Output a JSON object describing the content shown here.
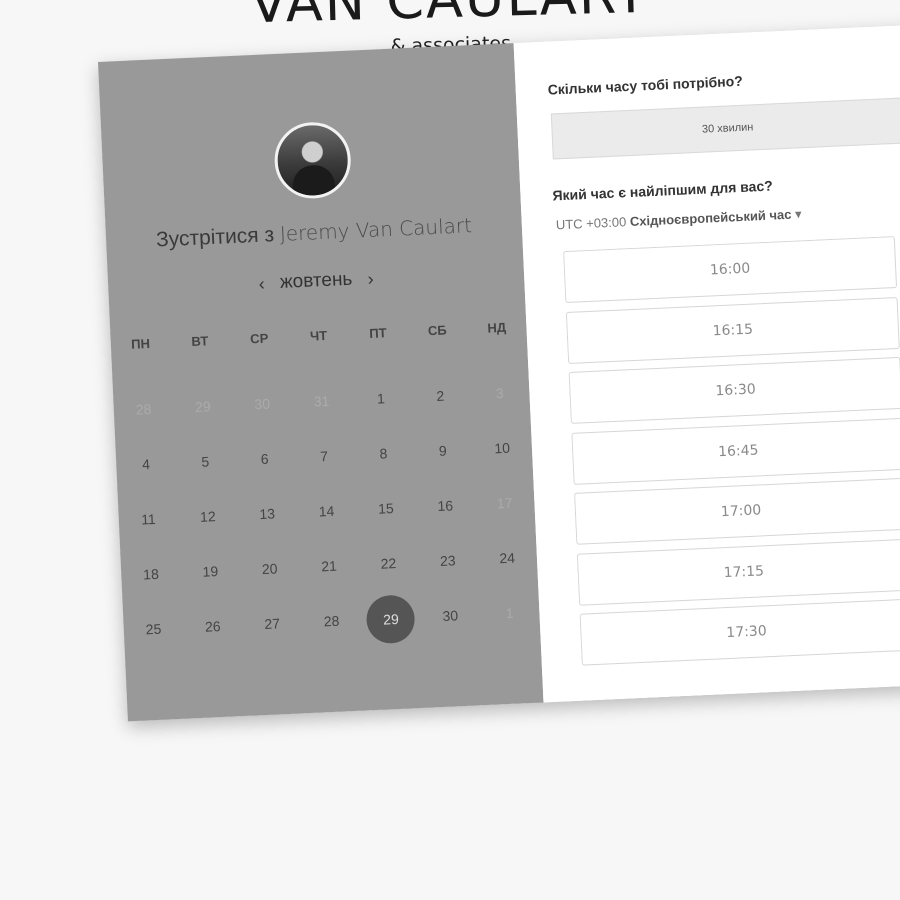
{
  "brand": {
    "title": "VAN CAULART",
    "subtitle": "& associates"
  },
  "left": {
    "meet_prefix": "Зустрітися з",
    "host": "Jeremy Van Caulart",
    "month": "жовтень",
    "prev_icon": "‹",
    "next_icon": "›",
    "weekdays": [
      "ПН",
      "ВТ",
      "СР",
      "ЧТ",
      "ПТ",
      "СБ",
      "НД"
    ],
    "weeks": [
      [
        "28",
        "29",
        "30",
        "31",
        "1",
        "2",
        "3"
      ],
      [
        "4",
        "5",
        "6",
        "7",
        "8",
        "9",
        "10"
      ],
      [
        "11",
        "12",
        "13",
        "14",
        "15",
        "16",
        "17"
      ],
      [
        "18",
        "19",
        "20",
        "21",
        "22",
        "23",
        "24"
      ],
      [
        "25",
        "26",
        "27",
        "28",
        "29",
        "30",
        "1"
      ]
    ],
    "muted_days": [
      "0-0",
      "0-1",
      "0-2",
      "0-3",
      "0-6",
      "2-6",
      "4-6"
    ],
    "selected_day": "29"
  },
  "right": {
    "duration_question": "Скільки часу тобі потрібно?",
    "duration_value": "30 хвилин",
    "time_question": "Який час є найліпшим для вас?",
    "tz_offset": "UTC +03:00",
    "tz_name": "Східноєвропейський час",
    "tz_arrow": "▾",
    "slots": [
      "16:00",
      "16:15",
      "16:30",
      "16:45",
      "17:00",
      "17:15",
      "17:30",
      ""
    ]
  }
}
